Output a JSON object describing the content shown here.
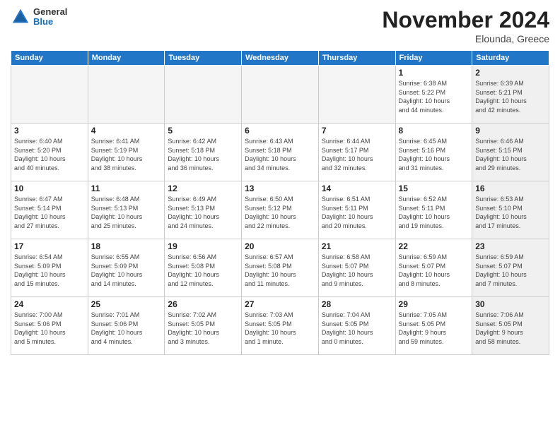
{
  "logo": {
    "general": "General",
    "blue": "Blue"
  },
  "header": {
    "month": "November 2024",
    "location": "Elounda, Greece"
  },
  "weekdays": [
    "Sunday",
    "Monday",
    "Tuesday",
    "Wednesday",
    "Thursday",
    "Friday",
    "Saturday"
  ],
  "weeks": [
    [
      {
        "day": "",
        "info": "",
        "empty": true
      },
      {
        "day": "",
        "info": "",
        "empty": true
      },
      {
        "day": "",
        "info": "",
        "empty": true
      },
      {
        "day": "",
        "info": "",
        "empty": true
      },
      {
        "day": "",
        "info": "",
        "empty": true
      },
      {
        "day": "1",
        "info": "Sunrise: 6:38 AM\nSunset: 5:22 PM\nDaylight: 10 hours\nand 44 minutes.",
        "shaded": false
      },
      {
        "day": "2",
        "info": "Sunrise: 6:39 AM\nSunset: 5:21 PM\nDaylight: 10 hours\nand 42 minutes.",
        "shaded": true
      }
    ],
    [
      {
        "day": "3",
        "info": "Sunrise: 6:40 AM\nSunset: 5:20 PM\nDaylight: 10 hours\nand 40 minutes.",
        "shaded": false
      },
      {
        "day": "4",
        "info": "Sunrise: 6:41 AM\nSunset: 5:19 PM\nDaylight: 10 hours\nand 38 minutes.",
        "shaded": false
      },
      {
        "day": "5",
        "info": "Sunrise: 6:42 AM\nSunset: 5:18 PM\nDaylight: 10 hours\nand 36 minutes.",
        "shaded": false
      },
      {
        "day": "6",
        "info": "Sunrise: 6:43 AM\nSunset: 5:18 PM\nDaylight: 10 hours\nand 34 minutes.",
        "shaded": false
      },
      {
        "day": "7",
        "info": "Sunrise: 6:44 AM\nSunset: 5:17 PM\nDaylight: 10 hours\nand 32 minutes.",
        "shaded": false
      },
      {
        "day": "8",
        "info": "Sunrise: 6:45 AM\nSunset: 5:16 PM\nDaylight: 10 hours\nand 31 minutes.",
        "shaded": false
      },
      {
        "day": "9",
        "info": "Sunrise: 6:46 AM\nSunset: 5:15 PM\nDaylight: 10 hours\nand 29 minutes.",
        "shaded": true
      }
    ],
    [
      {
        "day": "10",
        "info": "Sunrise: 6:47 AM\nSunset: 5:14 PM\nDaylight: 10 hours\nand 27 minutes.",
        "shaded": false
      },
      {
        "day": "11",
        "info": "Sunrise: 6:48 AM\nSunset: 5:13 PM\nDaylight: 10 hours\nand 25 minutes.",
        "shaded": false
      },
      {
        "day": "12",
        "info": "Sunrise: 6:49 AM\nSunset: 5:13 PM\nDaylight: 10 hours\nand 24 minutes.",
        "shaded": false
      },
      {
        "day": "13",
        "info": "Sunrise: 6:50 AM\nSunset: 5:12 PM\nDaylight: 10 hours\nand 22 minutes.",
        "shaded": false
      },
      {
        "day": "14",
        "info": "Sunrise: 6:51 AM\nSunset: 5:11 PM\nDaylight: 10 hours\nand 20 minutes.",
        "shaded": false
      },
      {
        "day": "15",
        "info": "Sunrise: 6:52 AM\nSunset: 5:11 PM\nDaylight: 10 hours\nand 19 minutes.",
        "shaded": false
      },
      {
        "day": "16",
        "info": "Sunrise: 6:53 AM\nSunset: 5:10 PM\nDaylight: 10 hours\nand 17 minutes.",
        "shaded": true
      }
    ],
    [
      {
        "day": "17",
        "info": "Sunrise: 6:54 AM\nSunset: 5:09 PM\nDaylight: 10 hours\nand 15 minutes.",
        "shaded": false
      },
      {
        "day": "18",
        "info": "Sunrise: 6:55 AM\nSunset: 5:09 PM\nDaylight: 10 hours\nand 14 minutes.",
        "shaded": false
      },
      {
        "day": "19",
        "info": "Sunrise: 6:56 AM\nSunset: 5:08 PM\nDaylight: 10 hours\nand 12 minutes.",
        "shaded": false
      },
      {
        "day": "20",
        "info": "Sunrise: 6:57 AM\nSunset: 5:08 PM\nDaylight: 10 hours\nand 11 minutes.",
        "shaded": false
      },
      {
        "day": "21",
        "info": "Sunrise: 6:58 AM\nSunset: 5:07 PM\nDaylight: 10 hours\nand 9 minutes.",
        "shaded": false
      },
      {
        "day": "22",
        "info": "Sunrise: 6:59 AM\nSunset: 5:07 PM\nDaylight: 10 hours\nand 8 minutes.",
        "shaded": false
      },
      {
        "day": "23",
        "info": "Sunrise: 6:59 AM\nSunset: 5:07 PM\nDaylight: 10 hours\nand 7 minutes.",
        "shaded": true
      }
    ],
    [
      {
        "day": "24",
        "info": "Sunrise: 7:00 AM\nSunset: 5:06 PM\nDaylight: 10 hours\nand 5 minutes.",
        "shaded": false
      },
      {
        "day": "25",
        "info": "Sunrise: 7:01 AM\nSunset: 5:06 PM\nDaylight: 10 hours\nand 4 minutes.",
        "shaded": false
      },
      {
        "day": "26",
        "info": "Sunrise: 7:02 AM\nSunset: 5:05 PM\nDaylight: 10 hours\nand 3 minutes.",
        "shaded": false
      },
      {
        "day": "27",
        "info": "Sunrise: 7:03 AM\nSunset: 5:05 PM\nDaylight: 10 hours\nand 1 minute.",
        "shaded": false
      },
      {
        "day": "28",
        "info": "Sunrise: 7:04 AM\nSunset: 5:05 PM\nDaylight: 10 hours\nand 0 minutes.",
        "shaded": false
      },
      {
        "day": "29",
        "info": "Sunrise: 7:05 AM\nSunset: 5:05 PM\nDaylight: 9 hours\nand 59 minutes.",
        "shaded": false
      },
      {
        "day": "30",
        "info": "Sunrise: 7:06 AM\nSunset: 5:05 PM\nDaylight: 9 hours\nand 58 minutes.",
        "shaded": true
      }
    ]
  ]
}
